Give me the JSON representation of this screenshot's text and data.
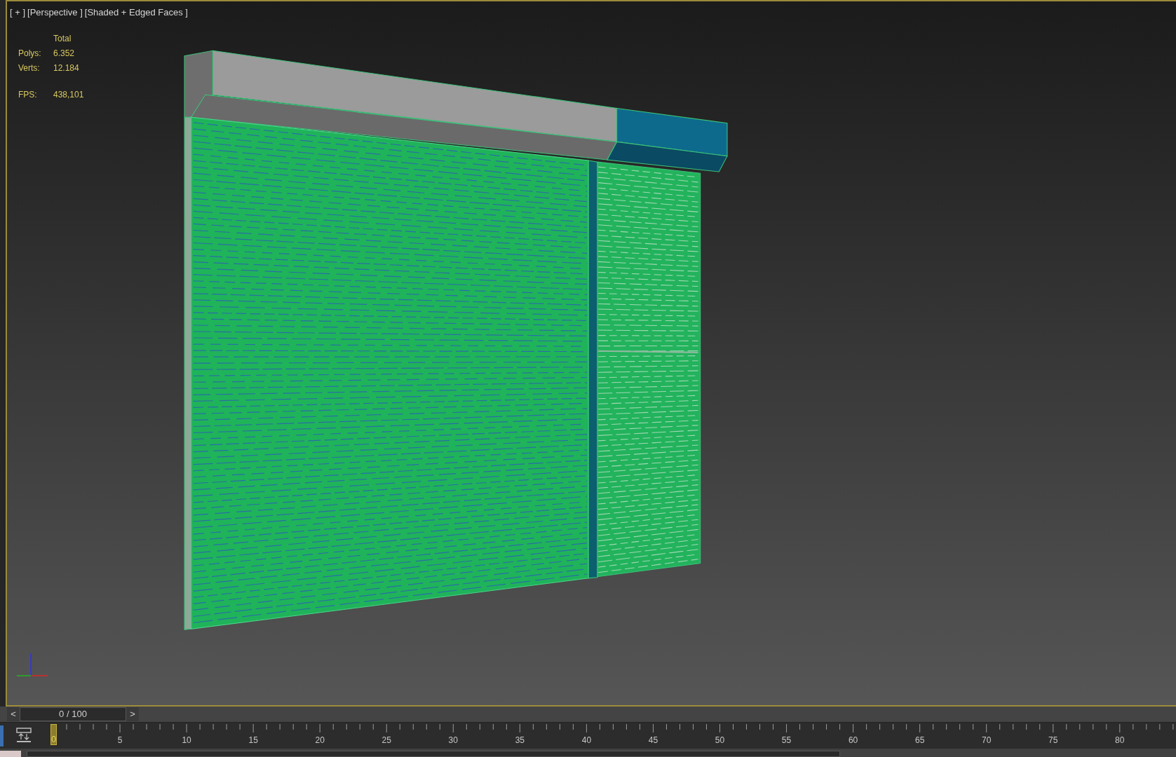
{
  "viewport": {
    "labels": [
      "[ + ]",
      "[Perspective ]",
      "[Shaded + Edged Faces ]"
    ],
    "stats": {
      "header": "Total",
      "rows": [
        {
          "label": "Polys:",
          "value": "6.352"
        },
        {
          "label": "Verts:",
          "value": "12.184"
        }
      ],
      "fps": {
        "label": "FPS:",
        "value": "438,101"
      }
    }
  },
  "time_slider": {
    "prev": "<",
    "frame": "0 / 100",
    "next": ">"
  },
  "track_bar": {
    "current_frame": "0",
    "labels": [
      "5",
      "10",
      "15",
      "20",
      "25",
      "30",
      "35",
      "40",
      "45",
      "50",
      "55",
      "60",
      "65",
      "70",
      "75",
      "80"
    ]
  }
}
